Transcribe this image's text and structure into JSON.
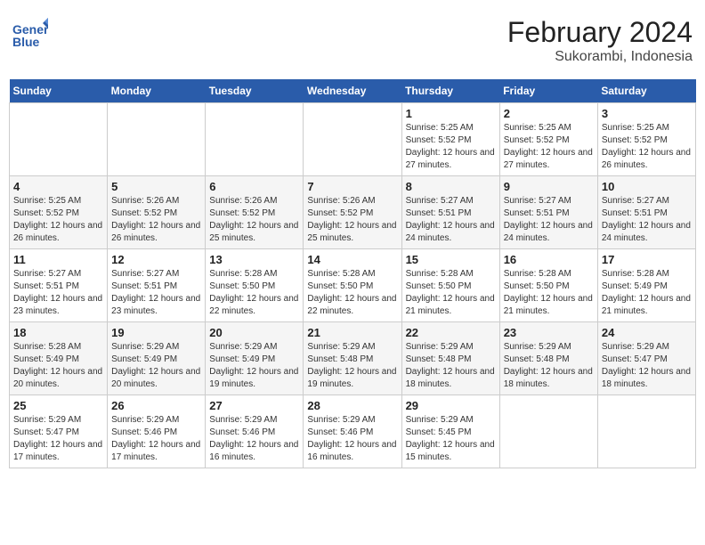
{
  "header": {
    "logo_line1": "General",
    "logo_line2": "Blue",
    "title": "February 2024",
    "subtitle": "Sukorambi, Indonesia"
  },
  "days_of_week": [
    "Sunday",
    "Monday",
    "Tuesday",
    "Wednesday",
    "Thursday",
    "Friday",
    "Saturday"
  ],
  "weeks": [
    [
      {
        "day": "",
        "info": ""
      },
      {
        "day": "",
        "info": ""
      },
      {
        "day": "",
        "info": ""
      },
      {
        "day": "",
        "info": ""
      },
      {
        "day": "1",
        "info": "Sunrise: 5:25 AM\nSunset: 5:52 PM\nDaylight: 12 hours and 27 minutes."
      },
      {
        "day": "2",
        "info": "Sunrise: 5:25 AM\nSunset: 5:52 PM\nDaylight: 12 hours and 27 minutes."
      },
      {
        "day": "3",
        "info": "Sunrise: 5:25 AM\nSunset: 5:52 PM\nDaylight: 12 hours and 26 minutes."
      }
    ],
    [
      {
        "day": "4",
        "info": "Sunrise: 5:25 AM\nSunset: 5:52 PM\nDaylight: 12 hours and 26 minutes."
      },
      {
        "day": "5",
        "info": "Sunrise: 5:26 AM\nSunset: 5:52 PM\nDaylight: 12 hours and 26 minutes."
      },
      {
        "day": "6",
        "info": "Sunrise: 5:26 AM\nSunset: 5:52 PM\nDaylight: 12 hours and 25 minutes."
      },
      {
        "day": "7",
        "info": "Sunrise: 5:26 AM\nSunset: 5:52 PM\nDaylight: 12 hours and 25 minutes."
      },
      {
        "day": "8",
        "info": "Sunrise: 5:27 AM\nSunset: 5:51 PM\nDaylight: 12 hours and 24 minutes."
      },
      {
        "day": "9",
        "info": "Sunrise: 5:27 AM\nSunset: 5:51 PM\nDaylight: 12 hours and 24 minutes."
      },
      {
        "day": "10",
        "info": "Sunrise: 5:27 AM\nSunset: 5:51 PM\nDaylight: 12 hours and 24 minutes."
      }
    ],
    [
      {
        "day": "11",
        "info": "Sunrise: 5:27 AM\nSunset: 5:51 PM\nDaylight: 12 hours and 23 minutes."
      },
      {
        "day": "12",
        "info": "Sunrise: 5:27 AM\nSunset: 5:51 PM\nDaylight: 12 hours and 23 minutes."
      },
      {
        "day": "13",
        "info": "Sunrise: 5:28 AM\nSunset: 5:50 PM\nDaylight: 12 hours and 22 minutes."
      },
      {
        "day": "14",
        "info": "Sunrise: 5:28 AM\nSunset: 5:50 PM\nDaylight: 12 hours and 22 minutes."
      },
      {
        "day": "15",
        "info": "Sunrise: 5:28 AM\nSunset: 5:50 PM\nDaylight: 12 hours and 21 minutes."
      },
      {
        "day": "16",
        "info": "Sunrise: 5:28 AM\nSunset: 5:50 PM\nDaylight: 12 hours and 21 minutes."
      },
      {
        "day": "17",
        "info": "Sunrise: 5:28 AM\nSunset: 5:49 PM\nDaylight: 12 hours and 21 minutes."
      }
    ],
    [
      {
        "day": "18",
        "info": "Sunrise: 5:28 AM\nSunset: 5:49 PM\nDaylight: 12 hours and 20 minutes."
      },
      {
        "day": "19",
        "info": "Sunrise: 5:29 AM\nSunset: 5:49 PM\nDaylight: 12 hours and 20 minutes."
      },
      {
        "day": "20",
        "info": "Sunrise: 5:29 AM\nSunset: 5:49 PM\nDaylight: 12 hours and 19 minutes."
      },
      {
        "day": "21",
        "info": "Sunrise: 5:29 AM\nSunset: 5:48 PM\nDaylight: 12 hours and 19 minutes."
      },
      {
        "day": "22",
        "info": "Sunrise: 5:29 AM\nSunset: 5:48 PM\nDaylight: 12 hours and 18 minutes."
      },
      {
        "day": "23",
        "info": "Sunrise: 5:29 AM\nSunset: 5:48 PM\nDaylight: 12 hours and 18 minutes."
      },
      {
        "day": "24",
        "info": "Sunrise: 5:29 AM\nSunset: 5:47 PM\nDaylight: 12 hours and 18 minutes."
      }
    ],
    [
      {
        "day": "25",
        "info": "Sunrise: 5:29 AM\nSunset: 5:47 PM\nDaylight: 12 hours and 17 minutes."
      },
      {
        "day": "26",
        "info": "Sunrise: 5:29 AM\nSunset: 5:46 PM\nDaylight: 12 hours and 17 minutes."
      },
      {
        "day": "27",
        "info": "Sunrise: 5:29 AM\nSunset: 5:46 PM\nDaylight: 12 hours and 16 minutes."
      },
      {
        "day": "28",
        "info": "Sunrise: 5:29 AM\nSunset: 5:46 PM\nDaylight: 12 hours and 16 minutes."
      },
      {
        "day": "29",
        "info": "Sunrise: 5:29 AM\nSunset: 5:45 PM\nDaylight: 12 hours and 15 minutes."
      },
      {
        "day": "",
        "info": ""
      },
      {
        "day": "",
        "info": ""
      }
    ]
  ]
}
